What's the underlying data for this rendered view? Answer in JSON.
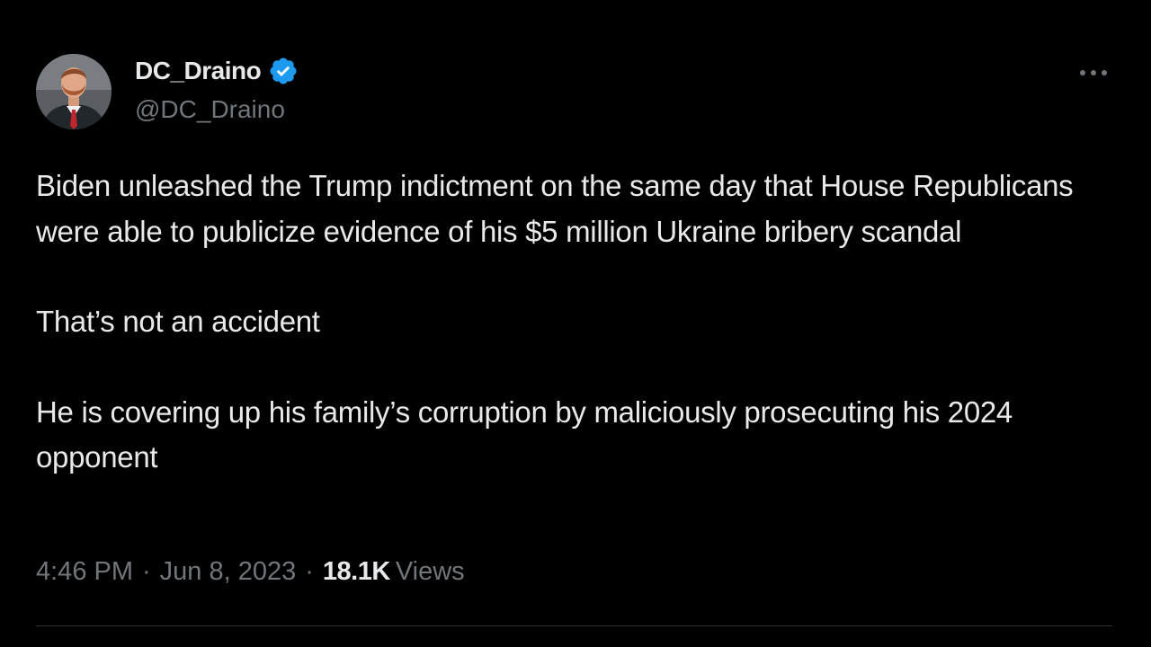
{
  "author": {
    "display_name": "DC_Draino",
    "handle": "@DC_Draino",
    "verified": true,
    "avatar_icon": "profile-photo"
  },
  "tweet": {
    "paragraphs": [
      "Biden unleashed the Trump indictment on the same day that House Republicans were able to publicize evidence of his $5 million Ukraine bribery scandal",
      "That’s not an accident",
      "He is covering up his family’s corruption by maliciously prosecuting his 2024 opponent"
    ]
  },
  "meta": {
    "time": "4:46 PM",
    "separator": "·",
    "date": "Jun 8, 2023",
    "views_count": "18.1K",
    "views_label": "Views"
  },
  "icons": {
    "verified": "verified-badge-icon",
    "more": "more-dots-icon"
  },
  "colors": {
    "background": "#000000",
    "primary_text": "#e7e9ea",
    "secondary_text": "#71767b",
    "verified_blue": "#1d9bf0",
    "divider": "#2f3336"
  }
}
